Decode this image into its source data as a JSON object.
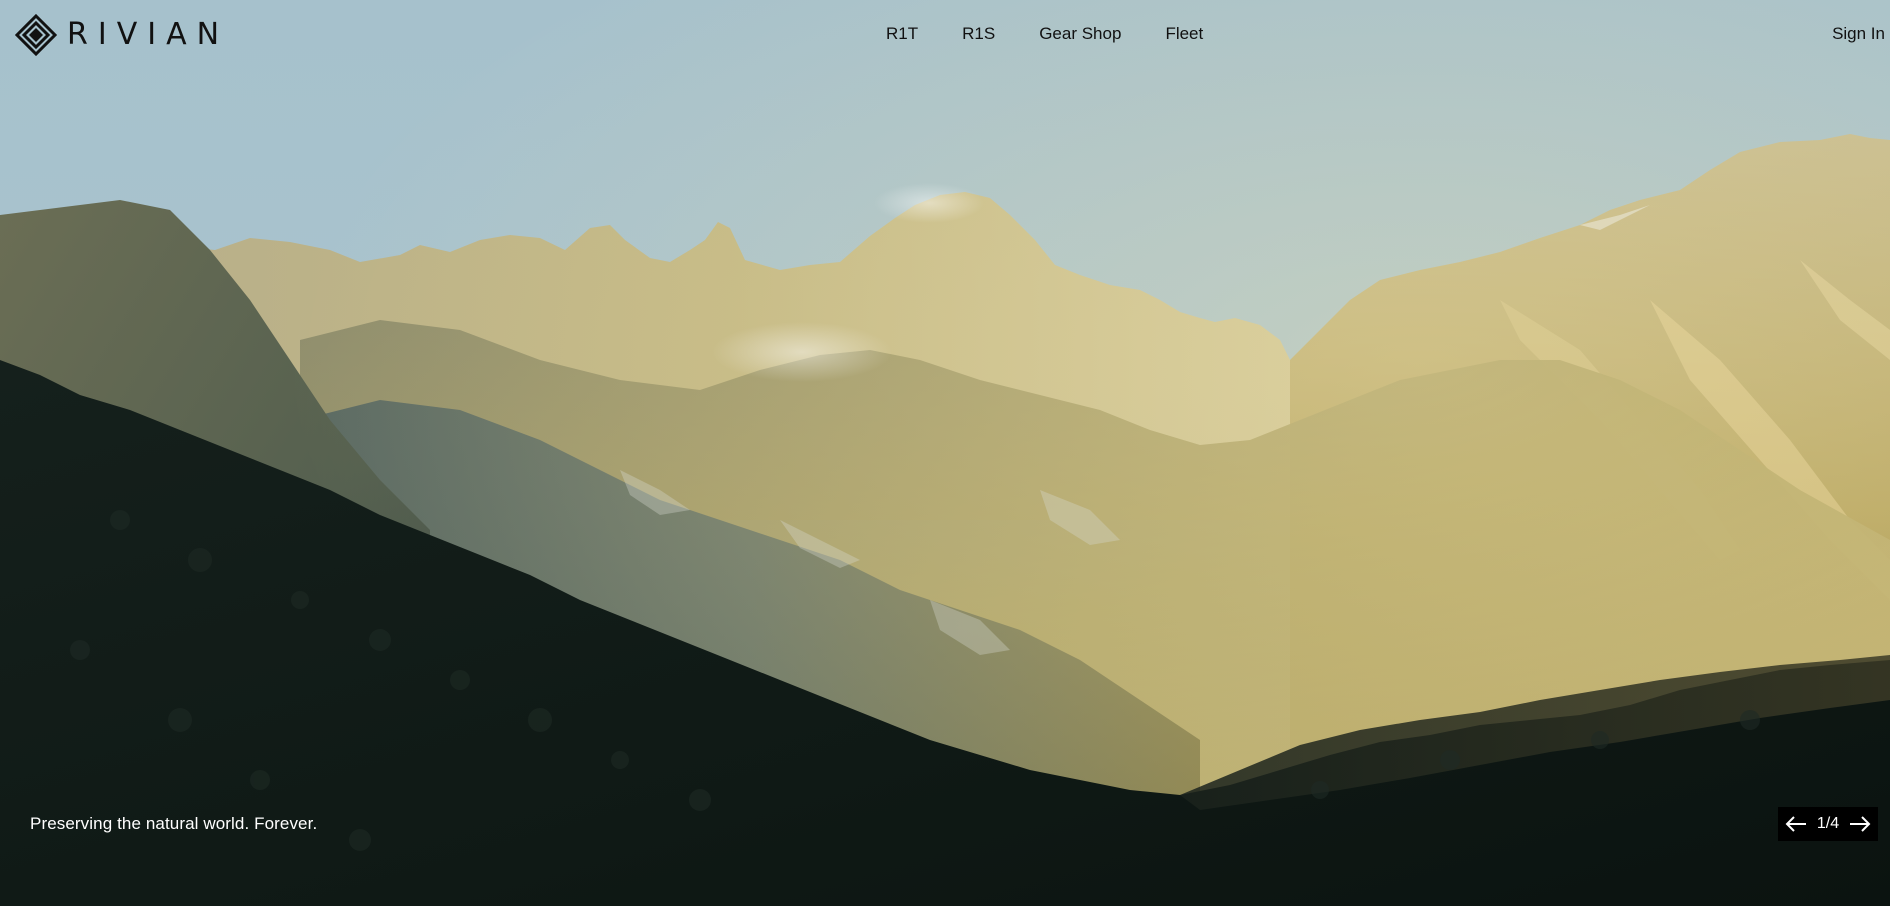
{
  "brand": {
    "name": "RIVIAN",
    "logo_icon": "rivian-compass-icon"
  },
  "nav": {
    "items": [
      {
        "label": "R1T"
      },
      {
        "label": "R1S"
      },
      {
        "label": "Gear Shop"
      },
      {
        "label": "Fleet"
      }
    ],
    "sign_in": "Sign In"
  },
  "hero": {
    "caption": "Preserving the natural world. Forever.",
    "slide_counter": "1/4",
    "prev_icon": "arrow-left-icon",
    "next_icon": "arrow-right-icon"
  },
  "colors": {
    "sky": "#a9c3cc",
    "sunlit_slope": "#b5a668",
    "foreground_forest": "#0e1714",
    "text_dark": "#111111",
    "text_light": "#ffffff",
    "control_bg": "#000000"
  }
}
